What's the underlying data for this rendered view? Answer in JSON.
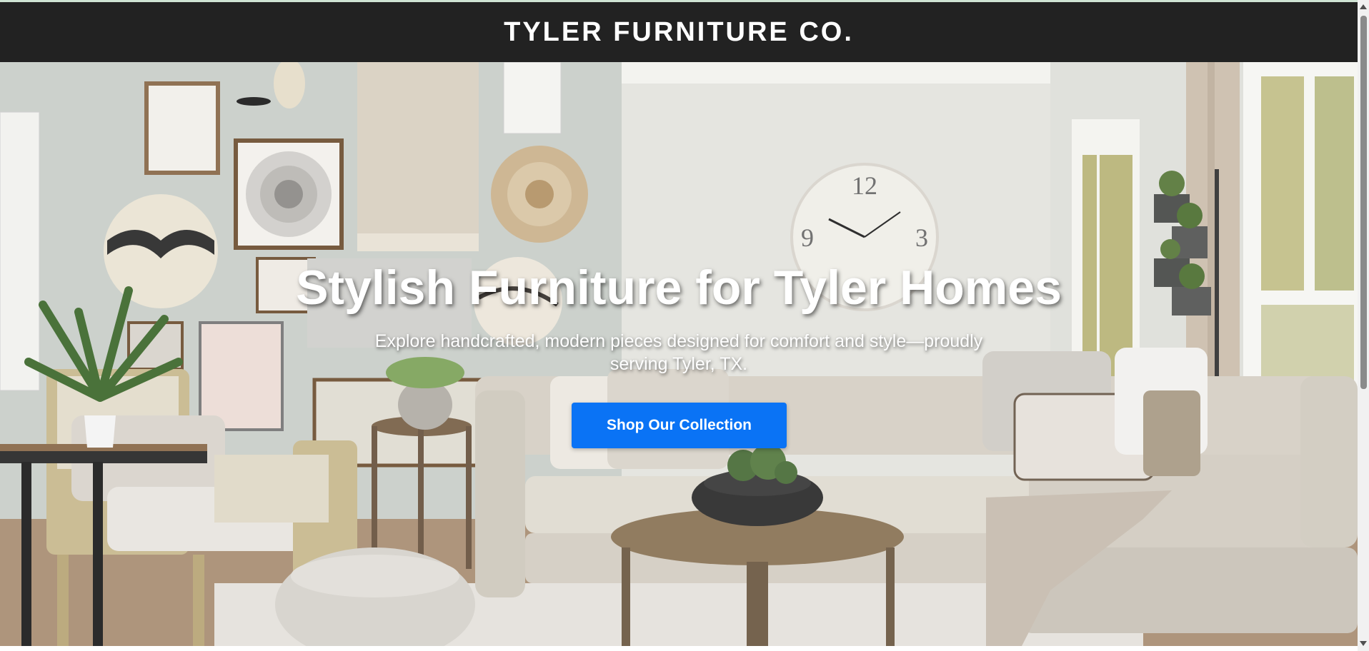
{
  "header": {
    "brand": "TYLER FURNITURE CO."
  },
  "hero": {
    "title": "Stylish Furniture for Tyler Homes",
    "subtitle": "Explore handcrafted, modern pieces designed for comfort and style—proudly serving Tyler, TX.",
    "cta_label": "Shop Our Collection",
    "background_image": "living-room-photo"
  },
  "colors": {
    "header_bg": "#222222",
    "cta_bg": "#0a73f5",
    "text_light": "#ffffff"
  }
}
